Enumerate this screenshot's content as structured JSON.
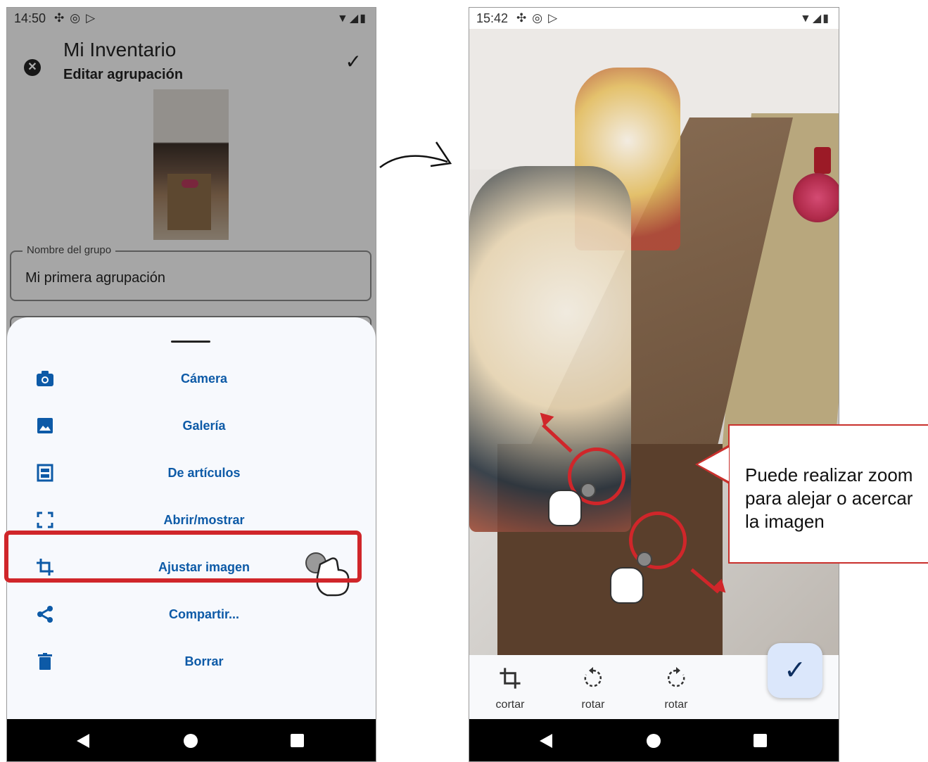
{
  "left_screen": {
    "status": {
      "time": "14:50"
    },
    "header": {
      "title": "Mi Inventario",
      "subtitle": "Editar agrupación"
    },
    "field": {
      "label": "Nombre del grupo",
      "value": "Mi primera agrupación"
    },
    "sheet": {
      "items": [
        {
          "label": "Cámera",
          "icon": "camera-icon"
        },
        {
          "label": "Galería",
          "icon": "image-icon"
        },
        {
          "label": "De artículos",
          "icon": "inventory-icon"
        },
        {
          "label": "Abrir/mostrar",
          "icon": "fullscreen-icon"
        },
        {
          "label": "Ajustar imagen",
          "icon": "crop-icon"
        },
        {
          "label": "Compartir...",
          "icon": "share-icon"
        },
        {
          "label": "Borrar",
          "icon": "trash-icon"
        }
      ]
    }
  },
  "right_screen": {
    "status": {
      "time": "15:42"
    },
    "toolbar": {
      "crop_label": "cortar",
      "rotate_left_label": "rotar",
      "rotate_right_label": "rotar"
    }
  },
  "callout": {
    "text": "Puede realizar zoom para alejar o acercar la imagen"
  },
  "colors": {
    "accent": "#0d5aa7",
    "highlight": "#d0262a"
  }
}
